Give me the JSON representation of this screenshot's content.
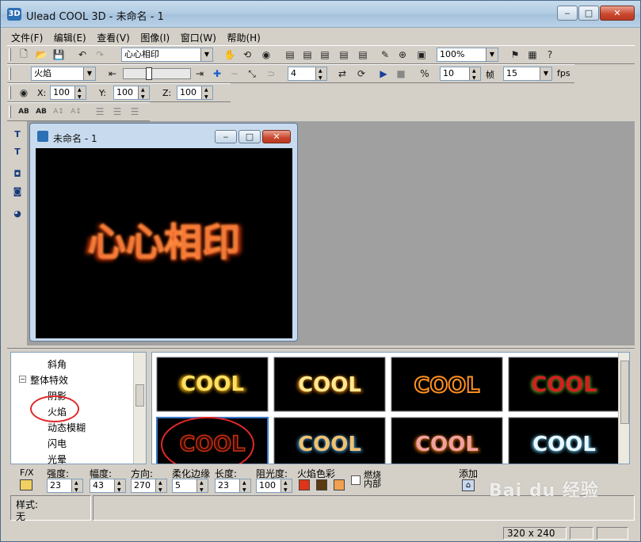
{
  "window": {
    "title": "Ulead COOL 3D - 未命名 - 1",
    "icon": "app-logo-icon"
  },
  "caption_buttons": {
    "minimize": "‒",
    "maximize": "□",
    "close": "✕"
  },
  "menu": [
    "文件(F)",
    "编辑(E)",
    "查看(V)",
    "图像(I)",
    "窗口(W)",
    "帮助(H)"
  ],
  "toolbar1": {
    "text_combo": "心心相印",
    "zoom_combo": "100%"
  },
  "toolbar2": {
    "effect_combo": "火焰",
    "frame_spin": "4",
    "frame_rate_spin": "10",
    "frame_label": "帧",
    "fps_combo": "15",
    "fps_label": "fps"
  },
  "toolbar3": {
    "x_label": "X:",
    "x_value": "100",
    "y_label": "Y:",
    "y_value": "100",
    "z_label": "Z:",
    "z_value": "100"
  },
  "toolbar4": {
    "labels": [
      "AB",
      "AB",
      "A↕",
      "A↕"
    ]
  },
  "document": {
    "title": "未命名 - 1",
    "canvas_text": "心心相印"
  },
  "tree": {
    "items": [
      "斜角",
      "整体特效",
      "阴影",
      "火焰",
      "动态模糊",
      "闪电",
      "光晕"
    ]
  },
  "thumbnails": [
    "COOL",
    "COOL",
    "COOL",
    "COOL",
    "COOL",
    "COOL",
    "COOL",
    "COOL"
  ],
  "params": {
    "fx_label": "F/X",
    "fields": [
      {
        "label": "强度:",
        "value": "23"
      },
      {
        "label": "幅度:",
        "value": "43"
      },
      {
        "label": "方向:",
        "value": "270"
      },
      {
        "label": "柔化边缘",
        "value": "5"
      },
      {
        "label": "长度:",
        "value": "23"
      },
      {
        "label": "阻光度:",
        "value": "100"
      }
    ],
    "flame_color_label": "火焰色彩",
    "colors": [
      "#e03418",
      "#5a3a10",
      "#f0a050"
    ],
    "burn_inside_label": "燃烧内部",
    "add_label": "添加"
  },
  "status": {
    "style_label": "样式:",
    "style_value": "无",
    "size": "320 x 240"
  },
  "watermark": "Bai du 经验"
}
